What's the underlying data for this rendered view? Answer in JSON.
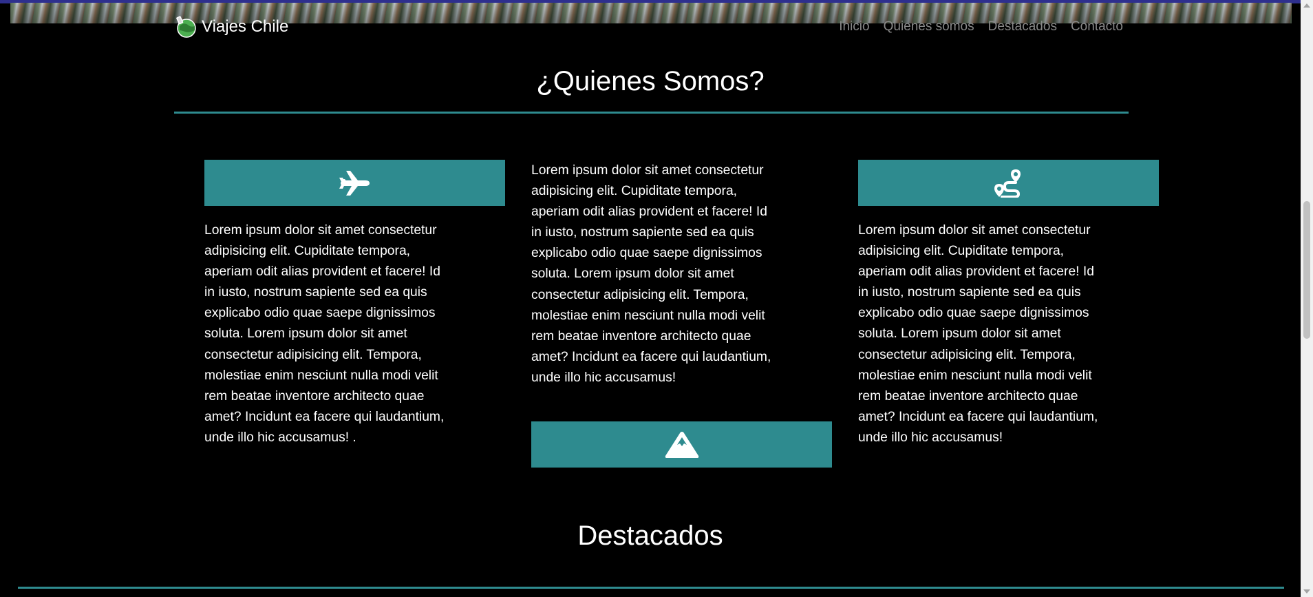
{
  "brand": {
    "name": "Viajes Chile",
    "logo_icon": "globe-traveler-icon"
  },
  "nav": {
    "items": [
      "Inicio",
      "Quienes somos",
      "Destacados",
      "Contacto"
    ]
  },
  "about": {
    "title": "¿Quienes Somos?",
    "accent_color": "#2e8b8f",
    "columns": [
      {
        "icon": "plane-icon",
        "text": "Lorem ipsum dolor sit amet consectetur adipisicing elit. Cupiditate tempora, aperiam odit alias provident et facere! Id in iusto, nostrum sapiente sed ea quis explicabo odio quae saepe dignissimos soluta. Lorem ipsum dolor sit amet consectetur adipisicing elit. Tempora, molestiae enim nesciunt nulla modi velit rem beatae inventore architecto quae amet? Incidunt ea facere qui laudantium, unde illo hic accusamus! ."
      },
      {
        "icon": "mountain-icon",
        "text": "Lorem ipsum dolor sit amet consectetur adipisicing elit. Cupiditate tempora, aperiam odit alias provident et facere! Id in iusto, nostrum sapiente sed ea quis explicabo odio quae saepe dignissimos soluta. Lorem ipsum dolor sit amet consectetur adipisicing elit. Tempora, molestiae enim nesciunt nulla modi velit rem beatae inventore architecto quae amet? Incidunt ea facere qui laudantium, unde illo hic accusamus!"
      },
      {
        "icon": "route-icon",
        "text": "Lorem ipsum dolor sit amet consectetur adipisicing elit. Cupiditate tempora, aperiam odit alias provident et facere! Id in iusto, nostrum sapiente sed ea quis explicabo odio quae saepe dignissimos soluta. Lorem ipsum dolor sit amet consectetur adipisicing elit. Tempora, molestiae enim nesciunt nulla modi velit rem beatae inventore architecto quae amet? Incidunt ea facere qui laudantium, unde illo hic accusamus!"
      }
    ]
  },
  "destacados": {
    "title": "Destacados"
  }
}
